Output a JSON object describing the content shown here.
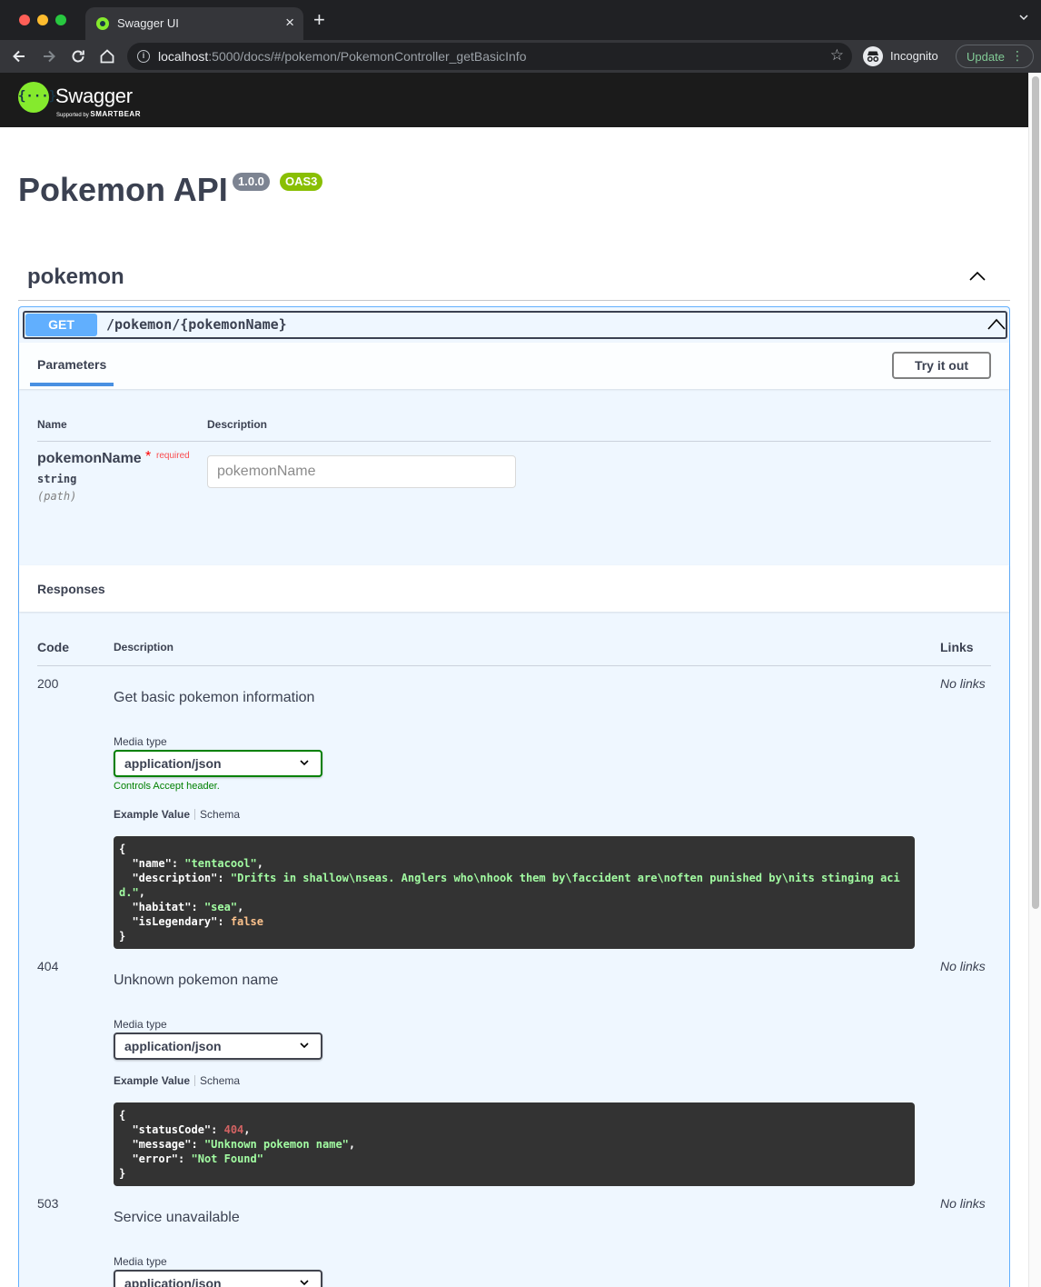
{
  "browser": {
    "tab_title": "Swagger UI",
    "tab_close": "×",
    "new_tab": "+",
    "url_host": "localhost",
    "url_rest": ":5000/docs/#/pokemon/PokemonController_getBasicInfo",
    "incognito_label": "Incognito",
    "update_label": "Update"
  },
  "swagger": {
    "logo_text": "Swagger",
    "logo_symbol": "{···}",
    "logo_sub_prefix": "Supported by",
    "logo_sub_brand": "SMARTBEAR"
  },
  "info": {
    "title": "Pokemon API",
    "version": "1.0.0",
    "oas": "OAS3"
  },
  "tag": {
    "name": "pokemon"
  },
  "operation": {
    "method": "GET",
    "path": "/pokemon/{pokemonName}",
    "parameters_tab": "Parameters",
    "try_it_out": "Try it out",
    "col_name": "Name",
    "col_description": "Description",
    "param": {
      "name": "pokemonName",
      "star": "*",
      "required": "required",
      "type": "string",
      "in": "(path)",
      "placeholder": "pokemonName"
    },
    "responses_title": "Responses",
    "resp_col_code": "Code",
    "resp_col_description": "Description",
    "resp_col_links": "Links",
    "responses": [
      {
        "code": "200",
        "description": "Get basic pokemon information",
        "links": "No links",
        "media_label": "Media type",
        "media_value": "application/json",
        "controls_accept": "Controls Accept header.",
        "example_tab": "Example Value",
        "schema_tab": "Schema",
        "example": {
          "name": "tentacool",
          "description": "Drifts in shallow\\nseas. Anglers who\\nhook them by\\faccident are\\noften punished by\\nits stinging aci",
          "description_wrap": "d.",
          "habitat": "sea",
          "isLegendary": "false"
        }
      },
      {
        "code": "404",
        "description": "Unknown pokemon name",
        "links": "No links",
        "media_label": "Media type",
        "media_value": "application/json",
        "example_tab": "Example Value",
        "schema_tab": "Schema",
        "example": {
          "statusCode": "404",
          "message": "Unknown pokemon name",
          "error": "Not Found"
        }
      },
      {
        "code": "503",
        "description": "Service unavailable",
        "links": "No links",
        "media_label": "Media type",
        "media_value": "application/json"
      }
    ]
  },
  "colors": {
    "get_accent": "#61affe",
    "swagger_green": "#85ea2d",
    "topbar_bg": "#1b1b1b",
    "version_badge": "#7d8492",
    "oas_badge": "#89bf04"
  }
}
